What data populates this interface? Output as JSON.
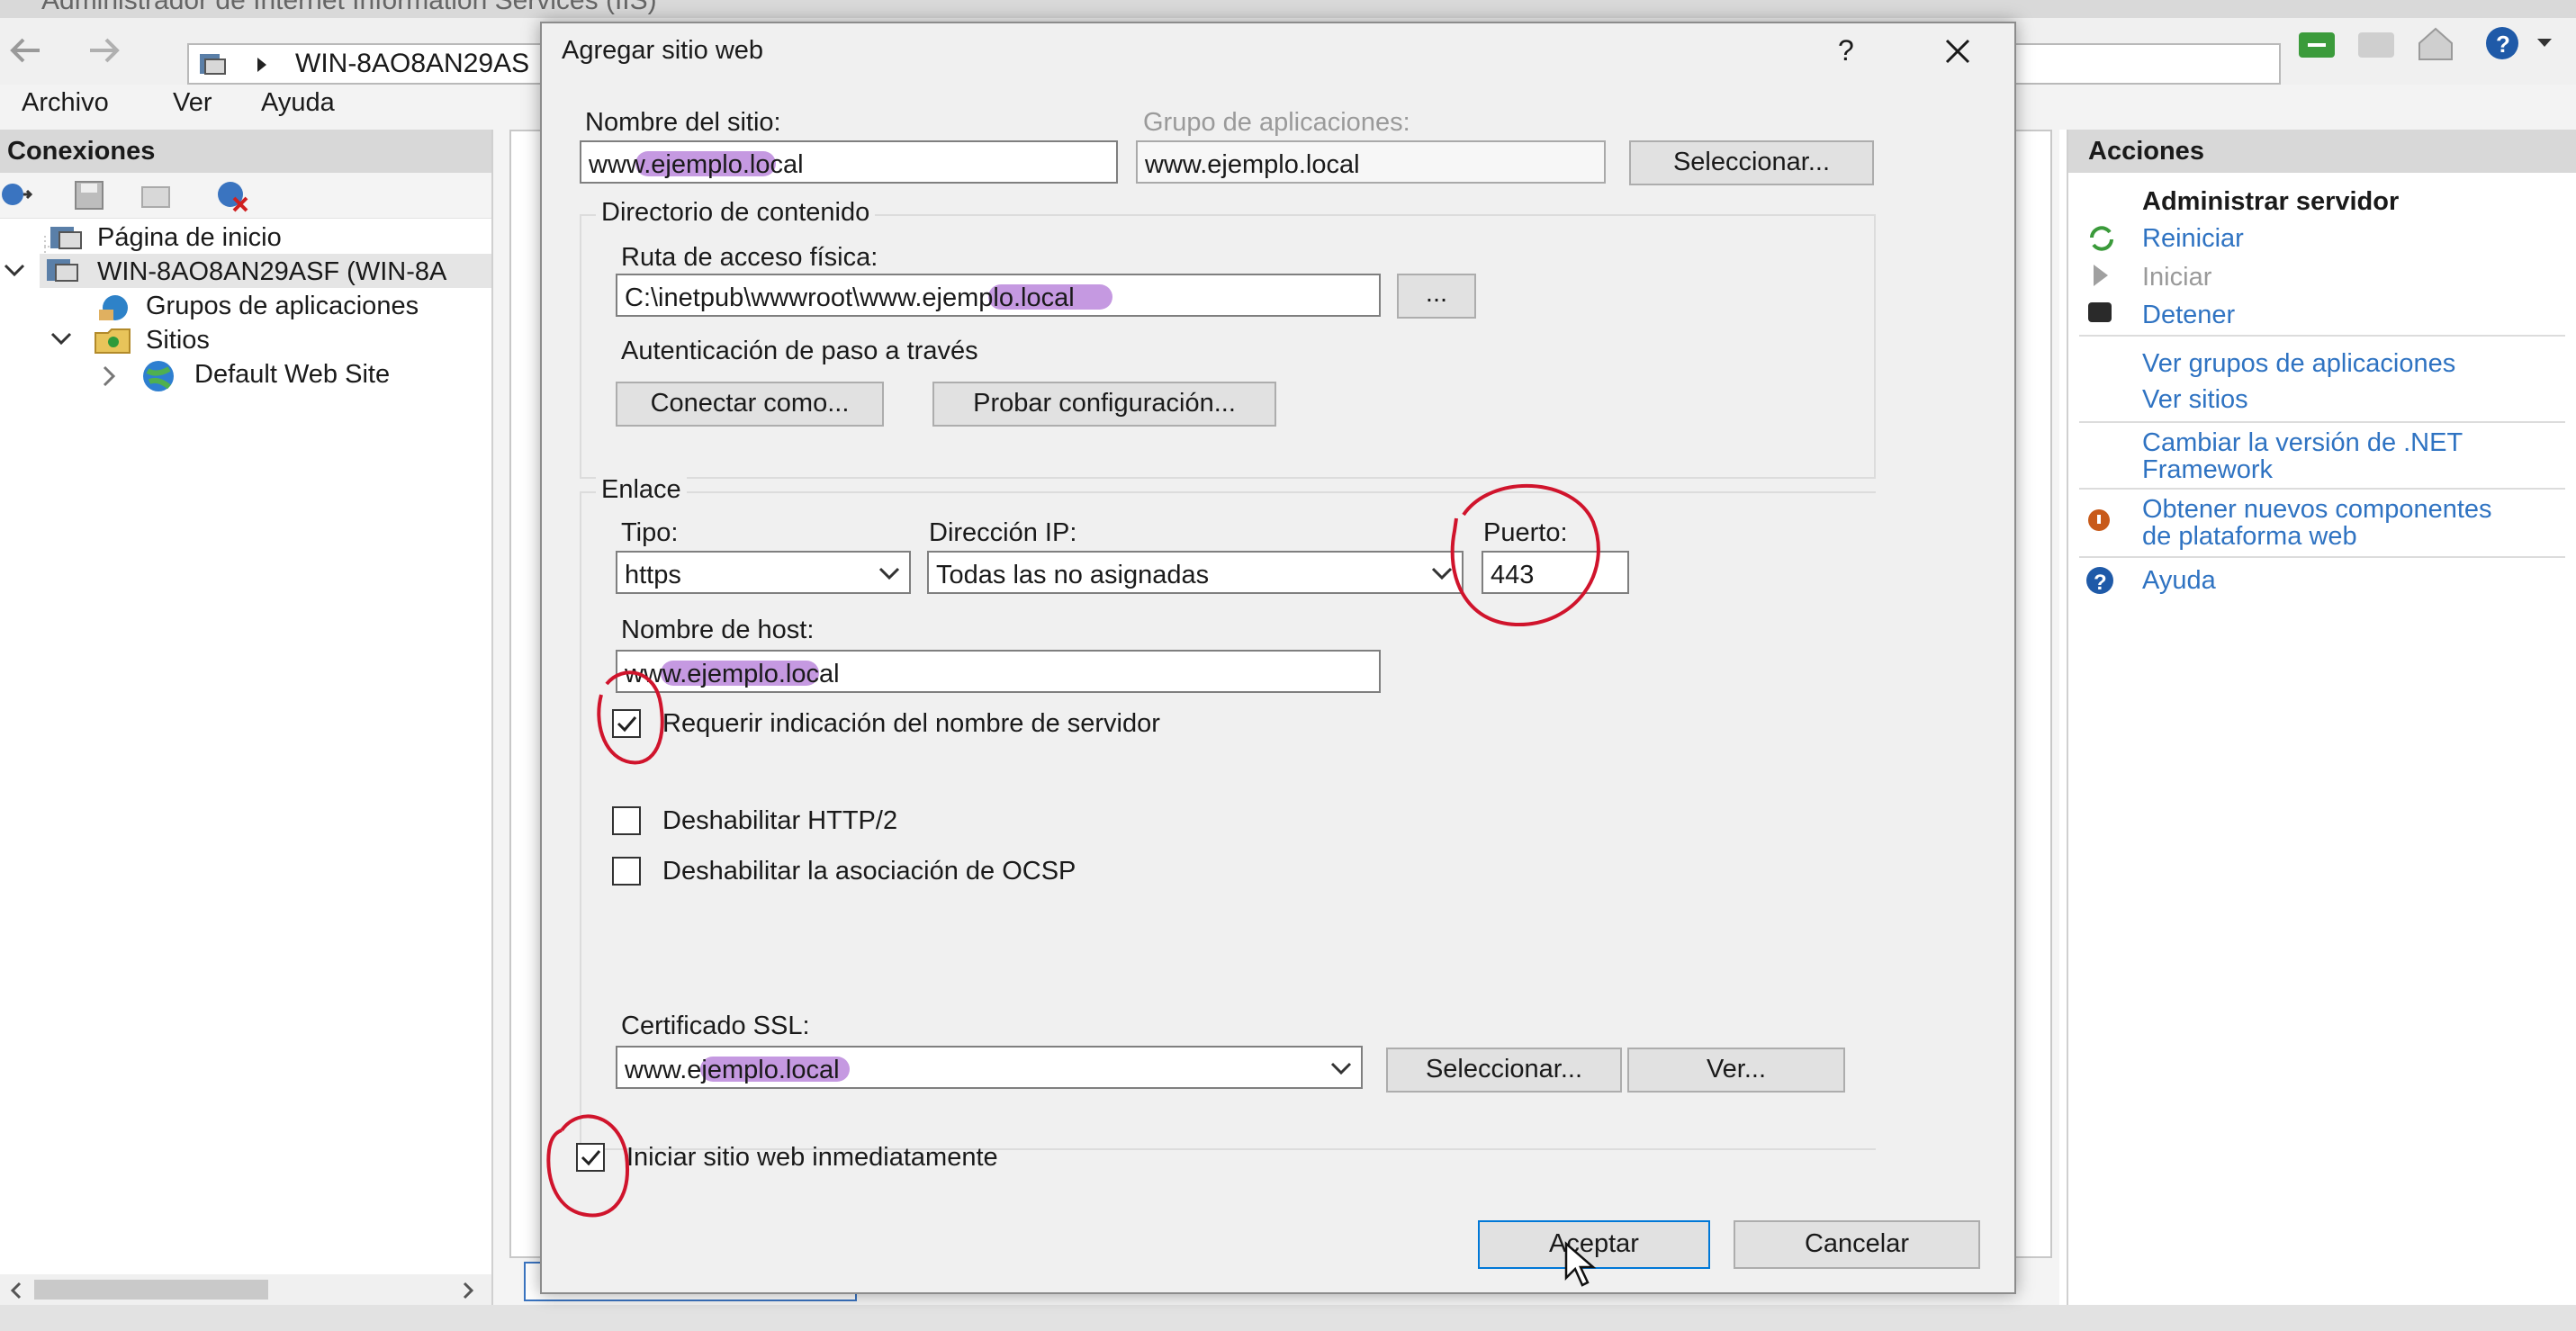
{
  "window": {
    "title_partial": "Administrador de Internet Information Services (IIS)",
    "address_path": "WIN-8AO8AN29AS"
  },
  "menu": {
    "items": [
      "Archivo",
      "Ver",
      "Ayuda"
    ]
  },
  "connections": {
    "header": "Conexiones",
    "tree": {
      "start_page": "Página de inicio",
      "server": "WIN-8AO8AN29ASF (WIN-8A",
      "app_pools": "Grupos de aplicaciones",
      "sites": "Sitios",
      "default_site": "Default Web Site"
    }
  },
  "actions": {
    "header": "Acciones",
    "section_title": "Administrar servidor",
    "restart": "Reiniciar",
    "start": "Iniciar",
    "stop": "Detener",
    "view_app_pools": "Ver grupos de aplicaciones",
    "view_sites": "Ver sitios",
    "change_net_line1": "Cambiar la versión de .NET",
    "change_net_line2": "Framework",
    "get_components_line1": "Obtener nuevos componentes",
    "get_components_line2": "de plataforma web",
    "help": "Ayuda"
  },
  "dialog": {
    "title": "Agregar sitio web",
    "help_glyph": "?",
    "site_name_label": "Nombre del sitio:",
    "site_name_value": "www.ejemplo.local",
    "app_pool_label": "Grupo de aplicaciones:",
    "app_pool_value": "www.ejemplo.local",
    "select_pool_button": "Seleccionar...",
    "content_group_label": "Directorio de contenido",
    "physical_path_label": "Ruta de acceso física:",
    "physical_path_value": "C:\\inetpub\\wwwroot\\www.ejemplo.local",
    "browse_button": "...",
    "passthrough_label": "Autenticación de paso a través",
    "connect_as_button": "Conectar como...",
    "test_settings_button": "Probar configuración...",
    "binding_group_label": "Enlace",
    "type_label": "Tipo:",
    "type_value": "https",
    "ip_label": "Dirección IP:",
    "ip_value": "Todas las no asignadas",
    "port_label": "Puerto:",
    "port_value": "443",
    "host_label": "Nombre de host:",
    "host_value": "www.ejemplo.local",
    "sni_label": "Requerir indicación del nombre de servidor",
    "sni_checked": true,
    "disable_http2_label": "Deshabilitar HTTP/2",
    "disable_http2_checked": false,
    "disable_ocsp_label": "Deshabilitar la asociación de OCSP",
    "disable_ocsp_checked": false,
    "ssl_label": "Certificado SSL:",
    "ssl_value": "www.ejemplo.local",
    "ssl_select_button": "Seleccionar...",
    "ssl_view_button": "Ver...",
    "start_immediately_label": "Iniciar sitio web inmediatamente",
    "start_immediately_checked": true,
    "ok_button": "Aceptar",
    "cancel_button": "Cancelar"
  },
  "colors": {
    "link": "#2f73c2",
    "annotation_red": "#d0142c",
    "highlight_purple": "#9646c8",
    "dialog_bg": "#f0f0f0",
    "primary_border": "#0078d7"
  },
  "icons": [
    "back-arrow-icon",
    "forward-arrow-icon",
    "server-icon",
    "home-icon",
    "help-icon",
    "close-icon",
    "check-icon",
    "chevron-down-icon",
    "refresh-icon",
    "play-icon",
    "stop-icon",
    "globe-icon",
    "folder-icon",
    "mouse-cursor-icon"
  ]
}
